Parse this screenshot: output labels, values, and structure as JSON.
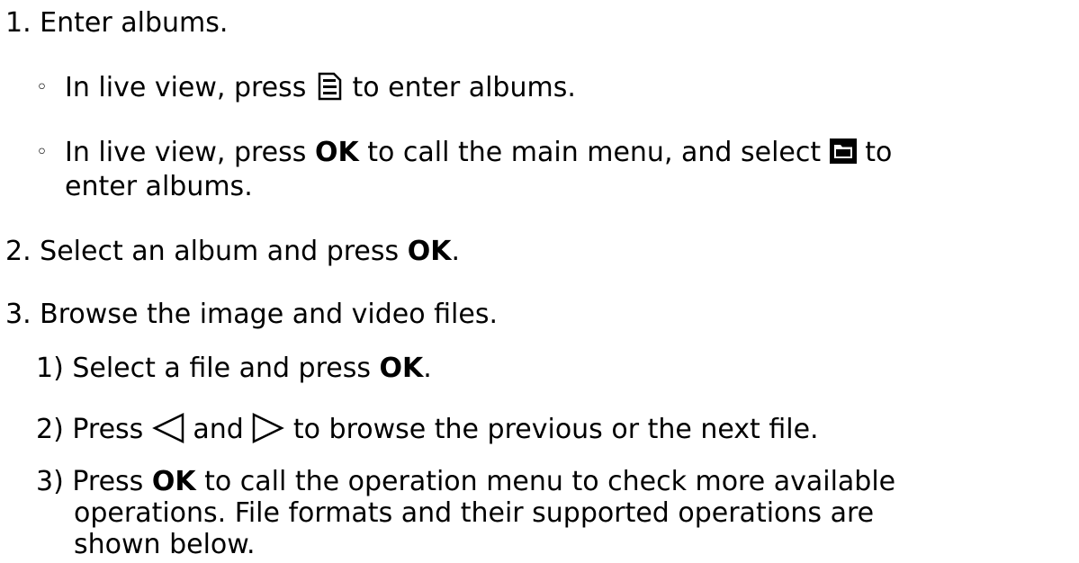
{
  "steps": [
    {
      "number": "1.",
      "text": "Enter albums."
    },
    {
      "number": "2.",
      "text_before": "Select an album and press ",
      "ok": "OK",
      "text_after": "."
    },
    {
      "number": "3.",
      "text": "Browse the image and video files."
    }
  ],
  "bullets": [
    {
      "marker": "◦",
      "text_before": "In live view, press ",
      "icon": "document-icon",
      "text_after": " to enter albums."
    },
    {
      "marker": "◦",
      "text_before": "In live view, press ",
      "ok": "OK",
      "text_middle": " to call the main menu, and select ",
      "icon": "folder-icon",
      "text_after": " to",
      "continuation": "enter albums."
    }
  ],
  "substeps": [
    {
      "number": "1)",
      "text_before": "Select a file and press ",
      "ok": "OK",
      "text_after": "."
    },
    {
      "number": "2)",
      "text_before": "Press ",
      "icon_left": "left-triangle-icon",
      "text_middle": " and ",
      "icon_right": "right-triangle-icon",
      "text_after": "  to browse the previous or the next file."
    },
    {
      "number": "3)",
      "text_before": "Press ",
      "ok": "OK",
      "text_after": " to call the operation menu to check more available",
      "continuation_1": "operations. File formats and their supported operations are",
      "continuation_2": "shown below."
    }
  ]
}
